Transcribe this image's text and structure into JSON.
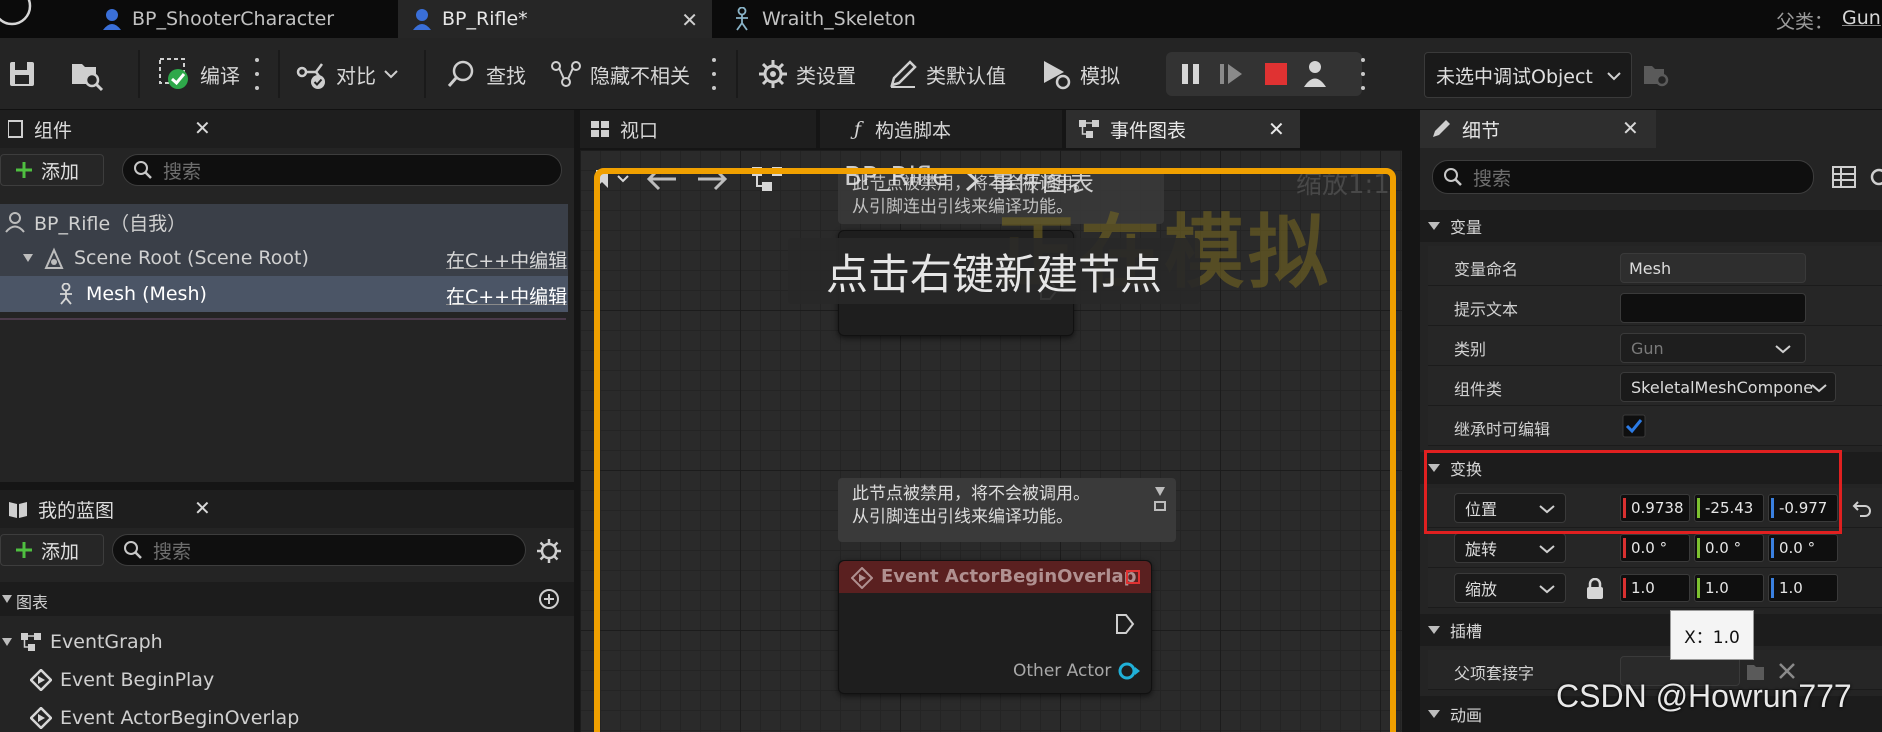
{
  "tabs": [
    {
      "label": "BP_ShooterCharacter",
      "active": false
    },
    {
      "label": "BP_Rifle*",
      "active": true
    },
    {
      "label": "Wraith_Skeleton",
      "active": false
    }
  ],
  "parent_class": {
    "label": "父类：",
    "value": "Gun"
  },
  "toolbar": {
    "compile": "编译",
    "diff": "对比",
    "find": "查找",
    "hide_unrelated": "隐藏不相关",
    "class_settings": "类设置",
    "class_defaults": "类默认值",
    "simulate": "模拟",
    "debug_object": "未选中调试Object"
  },
  "components": {
    "title": "组件",
    "add": "添加",
    "search_placeholder": "搜索",
    "items": [
      {
        "label": "BP_Rifle（自我）"
      },
      {
        "label": "Scene Root (Scene Root)",
        "action": "在C++中编辑"
      },
      {
        "label": "Mesh (Mesh)",
        "action": "在C++中编辑"
      }
    ]
  },
  "my_blueprint": {
    "title": "我的蓝图",
    "add": "添加",
    "search_placeholder": "搜索",
    "graphs_header": "图表",
    "items": [
      "EventGraph",
      "Event BeginPlay",
      "Event ActorBeginOverlap"
    ]
  },
  "center_tabs": {
    "viewport": "视口",
    "construction": "构造脚本",
    "event_graph": "事件图表"
  },
  "graph": {
    "breadcrumb_root": "BP_Rifle",
    "breadcrumb_current": "事件图表",
    "zoom": "缩放1:1",
    "simulating": "正在模拟",
    "hint": "点击右键新建节点",
    "disabled_line1": "此节点被禁用，将不会被调用。",
    "disabled_line2": "从引脚连出引线来编译功能。",
    "node_title": "Event ActorBeginOverlap",
    "pin_other_actor": "Other Actor"
  },
  "details": {
    "title": "细节",
    "search_placeholder": "搜索",
    "sections": {
      "variable": "变量",
      "transform": "变换",
      "sockets": "插槽",
      "animation": "动画"
    },
    "rows": {
      "var_name_label": "变量命名",
      "var_name": "Mesh",
      "tooltip_label": "提示文本",
      "tooltip": "",
      "category_label": "类别",
      "category": "Gun",
      "component_class_label": "组件类",
      "component_class": "SkeletalMeshCompone",
      "editable_label": "继承时可编辑",
      "location_label": "位置",
      "rotation_label": "旋转",
      "scale_label": "缩放",
      "parent_socket_label": "父项套接字"
    },
    "location": [
      "0.9738",
      "-25.43",
      "-0.977"
    ],
    "rotation": [
      "0.0 °",
      "0.0 °",
      "0.0 °"
    ],
    "scale": [
      "1.0",
      "1.0",
      "1.0"
    ],
    "tooltip_x": "X：1.0"
  },
  "watermark": "CSDN @Howrun777",
  "colors": {
    "accent": "#f0a000",
    "highlight": "#e02020",
    "axis_x": "#d83030",
    "axis_y": "#7cc030",
    "axis_z": "#3a80e0",
    "stop": "#e03232"
  }
}
